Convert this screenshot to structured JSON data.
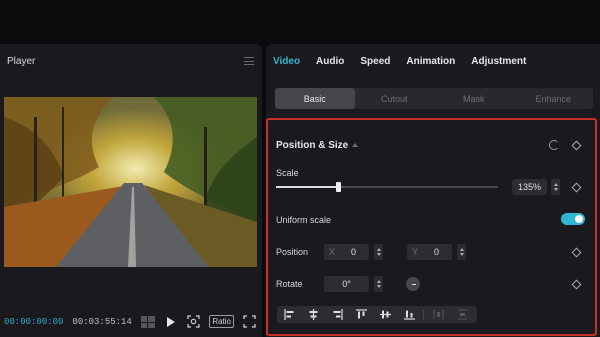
{
  "player": {
    "title": "Player",
    "timecode_current": "00:00:00:00",
    "timecode_total": "00:03:55:14",
    "ratio_label": "Ratio"
  },
  "inspector": {
    "tabs": [
      {
        "label": "Video",
        "active": true
      },
      {
        "label": "Audio",
        "active": false
      },
      {
        "label": "Speed",
        "active": false
      },
      {
        "label": "Animation",
        "active": false
      },
      {
        "label": "Adjustment",
        "active": false
      }
    ],
    "subtabs": [
      {
        "label": "Basic",
        "active": true
      },
      {
        "label": "Cutout",
        "active": false
      },
      {
        "label": "Mask",
        "active": false
      },
      {
        "label": "Enhance",
        "active": false
      }
    ],
    "section": {
      "title": "Position & Size",
      "scale_label": "Scale",
      "scale_value": "135%",
      "scale_fraction": 0.28,
      "uniform_scale_label": "Uniform scale",
      "uniform_scale_on": true,
      "position_label": "Position",
      "x_axis": "X",
      "x_value": "0",
      "y_axis": "Y",
      "y_value": "0",
      "rotate_label": "Rotate",
      "rotate_value": "0°"
    }
  },
  "colors": {
    "accent": "#35b6d0",
    "highlight_border": "#c9302c",
    "panel_bg": "#1a1a1e"
  },
  "icons": {
    "player_menu": "hamburger-menu-icon",
    "reset": "reset-icon",
    "keyframe": "diamond-keyframe-icon",
    "play": "play-icon",
    "fullscreen": "fullscreen-icon"
  }
}
